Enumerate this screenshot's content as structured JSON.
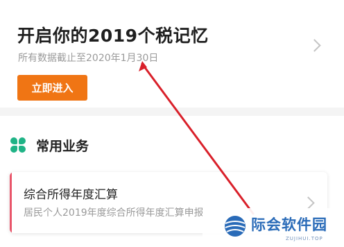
{
  "header": {
    "title": "开启你的2019个税记忆",
    "subtitle": "所有数据截止至2020年1月30日",
    "enter_button": "立即进入"
  },
  "section": {
    "title": "常用业务",
    "icon": "clover-icon",
    "items": [
      {
        "title": "综合所得年度汇算",
        "description": "居民个人2019年度综合所得年度汇算申报",
        "accent_color": "#e9556a"
      }
    ]
  },
  "watermark": {
    "text": "际会软件园",
    "sub": "ZUJIHUI.TOP"
  },
  "colors": {
    "accent_orange": "#f07514",
    "icon_green": "#1fb386",
    "annotation_arrow": "#d9202a"
  }
}
